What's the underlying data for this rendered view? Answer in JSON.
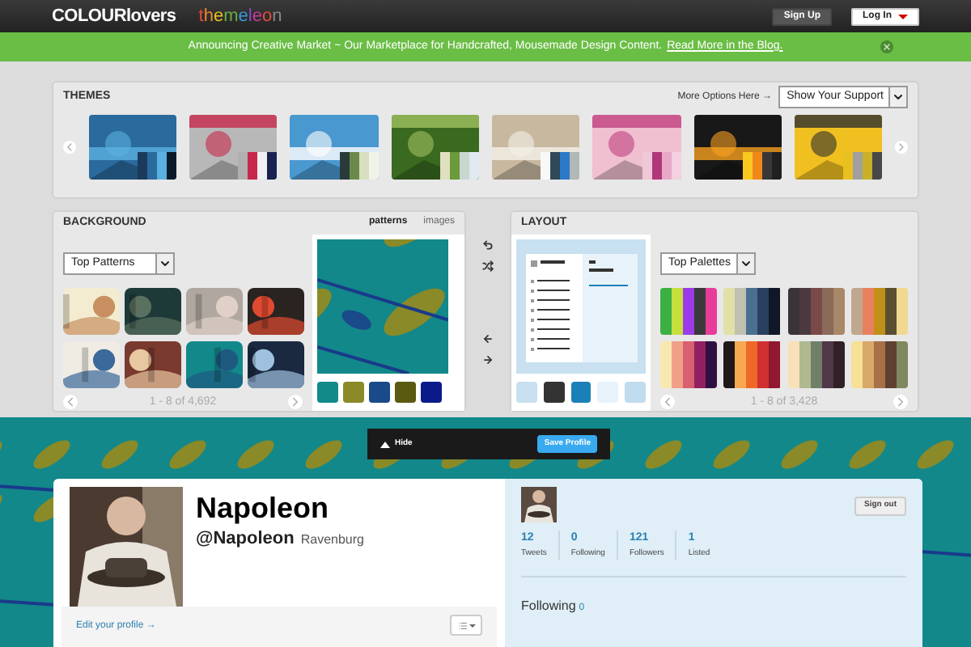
{
  "header": {
    "logo": "COLOURlovers",
    "sublogo": "themeleon",
    "buttons": [
      {
        "label": "Sign Up",
        "kind": "dark"
      },
      {
        "label": "Log In",
        "kind": "light"
      }
    ]
  },
  "announcement": {
    "text": "Announcing Creative Market ~ Our Marketplace for Handcrafted, Mousemade Design Content.",
    "link": "Read More in the Blog."
  },
  "themes": {
    "title": "THEMES",
    "more": "More Options Here →",
    "select": "Show Your Support",
    "items": [
      {
        "palette": [
          {
            "color": "#1c3a5c"
          },
          {
            "color": "#2a6a9c"
          },
          {
            "color": "#5ab0e0"
          },
          {
            "color": "#0a1a2a"
          }
        ]
      },
      {
        "palette": [
          {
            "color": "#b0b0b0"
          },
          {
            "color": "#c8284a"
          },
          {
            "color": "#f0f0f0"
          },
          {
            "color": "#1a2050"
          }
        ]
      },
      {
        "palette": [
          {
            "color": "#2a3a3a"
          },
          {
            "color": "#6a8a4a"
          },
          {
            "color": "#d8e0c0"
          },
          {
            "color": "#f0f4e8"
          }
        ]
      },
      {
        "palette": [
          {
            "color": "#e0e0c0"
          },
          {
            "color": "#6a9a3a"
          },
          {
            "color": "#c8d8d0"
          },
          {
            "color": "#e0e8f0"
          }
        ]
      },
      {
        "palette": [
          {
            "color": "#f8f8f8"
          },
          {
            "color": "#304858"
          },
          {
            "color": "#2a7ac8"
          },
          {
            "color": "#b0b8b8"
          }
        ]
      },
      {
        "palette": [
          {
            "color": "#f0c8d8"
          },
          {
            "color": "#b03878"
          },
          {
            "color": "#e8a8c8"
          },
          {
            "color": "#f4d0e0"
          }
        ]
      },
      {
        "palette": [
          {
            "color": "#f8c820"
          },
          {
            "color": "#f08818"
          },
          {
            "color": "#383838"
          },
          {
            "color": "#202020"
          }
        ]
      },
      {
        "palette": [
          {
            "color": "#e8c020"
          },
          {
            "color": "#a0a0a0"
          },
          {
            "color": "#c8b028"
          },
          {
            "color": "#484848"
          }
        ]
      }
    ]
  },
  "background": {
    "title": "BACKGROUND",
    "tabs": [
      {
        "label": "patterns",
        "selected": true
      },
      {
        "label": "images",
        "selected": false
      }
    ],
    "select": "Top Patterns",
    "pager": "1 - 8 of 4,692",
    "patterns": [
      {
        "color": "#f4ecd0"
      },
      {
        "color": "#1e3a38"
      },
      {
        "color": "#b0a8a0"
      },
      {
        "color": "#2a2420"
      },
      {
        "color": "#f0ece4"
      },
      {
        "color": "#7a3a30"
      },
      {
        "color": "#12888a"
      },
      {
        "color": "#1a2840"
      }
    ],
    "swatches": [
      {
        "color": "#128a8a"
      },
      {
        "color": "#8a8a28"
      },
      {
        "color": "#1a4a8a"
      },
      {
        "color": "#5a5a10"
      },
      {
        "color": "#0a1a8a"
      }
    ]
  },
  "layout": {
    "title": "LAYOUT",
    "select": "Top Palettes",
    "pager": "1 - 8 of 3,428",
    "swatches": [
      {
        "color": "#c8e0f0"
      },
      {
        "color": "#333333"
      },
      {
        "color": "#1a80b8"
      },
      {
        "color": "#e8f2fa"
      },
      {
        "color": "#c0dcee"
      }
    ],
    "palettes": [
      {
        "colors": [
          {
            "color": "#3cb043"
          },
          {
            "color": "#c8e03c"
          },
          {
            "color": "#9b3ce8"
          },
          {
            "color": "#3a3a3a"
          },
          {
            "color": "#e83c9b"
          }
        ]
      },
      {
        "colors": [
          {
            "color": "#e0e0a8"
          },
          {
            "color": "#c0c0b0"
          },
          {
            "color": "#4a7090"
          },
          {
            "color": "#2a4060"
          },
          {
            "color": "#101828"
          }
        ]
      },
      {
        "colors": [
          {
            "color": "#3a3438"
          },
          {
            "color": "#4a3a40"
          },
          {
            "color": "#7a4a48"
          },
          {
            "color": "#8a6a58"
          },
          {
            "color": "#a88868"
          }
        ]
      },
      {
        "colors": [
          {
            "color": "#c0a890"
          },
          {
            "color": "#e88060"
          },
          {
            "color": "#c09018"
          },
          {
            "color": "#5a5030"
          },
          {
            "color": "#f0d890"
          }
        ]
      },
      {
        "colors": [
          {
            "color": "#f8e8b0"
          },
          {
            "color": "#f0a088"
          },
          {
            "color": "#d86070"
          },
          {
            "color": "#902060"
          },
          {
            "color": "#301040"
          }
        ]
      },
      {
        "colors": [
          {
            "color": "#201818"
          },
          {
            "color": "#f8a850"
          },
          {
            "color": "#f06828"
          },
          {
            "color": "#d03030"
          },
          {
            "color": "#901830"
          }
        ]
      },
      {
        "colors": [
          {
            "color": "#f8e0b8"
          },
          {
            "color": "#b0b890"
          },
          {
            "color": "#708068"
          },
          {
            "color": "#503848"
          },
          {
            "color": "#302028"
          }
        ]
      },
      {
        "colors": [
          {
            "color": "#f8e098"
          },
          {
            "color": "#d8a868"
          },
          {
            "color": "#a87048"
          },
          {
            "color": "#604030"
          },
          {
            "color": "#808860"
          }
        ]
      }
    ]
  },
  "toolbar": {
    "hide": "Hide",
    "save": "Save Profile"
  },
  "profile": {
    "name": "Napoleon",
    "handle": "@Napoleon",
    "location": "Ravenburg",
    "edit": "Edit your profile →",
    "signout": "Sign out",
    "stats": [
      {
        "value": "12",
        "label": "Tweets"
      },
      {
        "value": "0",
        "label": "Following"
      },
      {
        "value": "121",
        "label": "Followers"
      },
      {
        "value": "1",
        "label": "Listed"
      }
    ],
    "following": "Following",
    "following_count": "0"
  }
}
